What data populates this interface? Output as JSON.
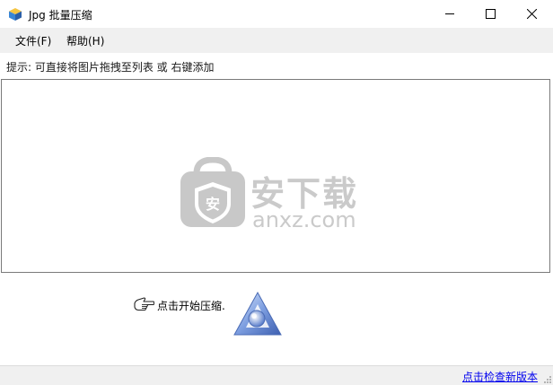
{
  "window": {
    "title": "Jpg 批量压缩",
    "app_icon": "app-cube-icon",
    "controls": [
      "minimize-icon",
      "maximize-icon",
      "close-icon"
    ]
  },
  "menu": {
    "items": [
      {
        "label": "文件(F)"
      },
      {
        "label": "帮助(H)"
      }
    ]
  },
  "hint": "提示: 可直接将图片拖拽至列表 或 右键添加",
  "file_list": {
    "watermark": {
      "text": "安下载",
      "subtext": "anxz.com",
      "icon": "shield-bag-icon"
    }
  },
  "action": {
    "pointer_icon": "pointing-hand-icon",
    "label": "点击开始压缩.",
    "logo_icon": "triangle-logo-icon"
  },
  "status": {
    "update_link": "点击检查新版本"
  },
  "colors": {
    "menu_bg": "#f0f0f0",
    "link": "#0000ee",
    "list_border": "#7a7a7a",
    "logo_blue": "#6a8fd0"
  }
}
